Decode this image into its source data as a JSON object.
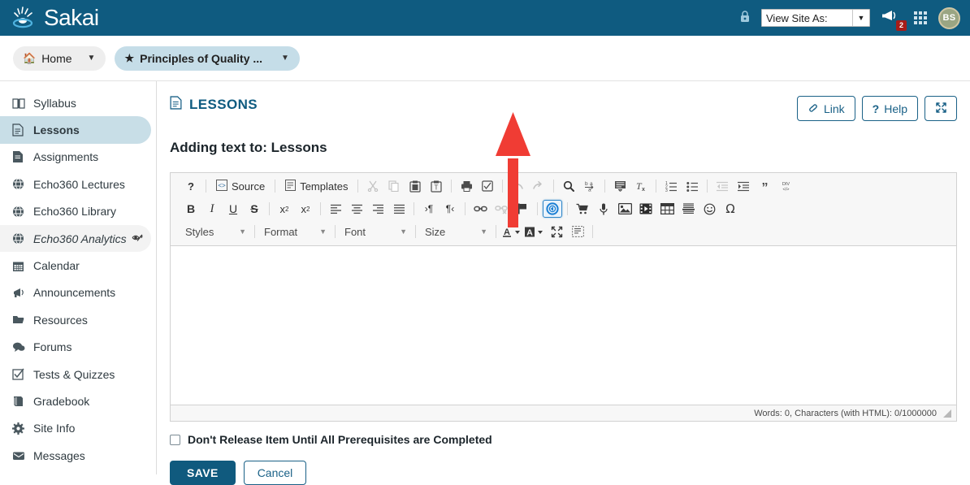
{
  "header": {
    "brand": "Sakai",
    "logo_icon": "sakai-water-drop-icon",
    "lock_icon": "lock-icon",
    "view_site_as": {
      "label": "View Site As:",
      "caret_icon": "chevron-down-icon"
    },
    "alerts": {
      "icon": "megaphone-icon",
      "badge_count": "2"
    },
    "grid_icon": "app-grid-icon",
    "avatar_initials": "BS",
    "colors": {
      "header_bg": "#0f5b80",
      "badge_red": "#a61c19"
    }
  },
  "site_nav": {
    "home": {
      "label": "Home",
      "icon": "home-icon",
      "caret_icon": "chevron-down-icon"
    },
    "site": {
      "label": "Principles of Quality ...",
      "icon": "star-icon",
      "caret_icon": "chevron-down-icon"
    }
  },
  "sidebar": {
    "items": [
      {
        "label": "Syllabus",
        "icon": "book-open-icon",
        "state": "normal"
      },
      {
        "label": "Lessons",
        "icon": "document-icon",
        "state": "active"
      },
      {
        "label": "Assignments",
        "icon": "page-edit-icon",
        "state": "normal"
      },
      {
        "label": "Echo360 Lectures",
        "icon": "globe-icon",
        "state": "normal"
      },
      {
        "label": "Echo360 Library",
        "icon": "globe-icon",
        "state": "normal"
      },
      {
        "label": "Echo360 Analytics",
        "icon": "globe-icon",
        "state": "hover",
        "suffix_icon": "eye-slash-icon"
      },
      {
        "label": "Calendar",
        "icon": "calendar-icon",
        "state": "normal"
      },
      {
        "label": "Announcements",
        "icon": "megaphone-icon",
        "state": "normal"
      },
      {
        "label": "Resources",
        "icon": "folder-open-icon",
        "state": "normal"
      },
      {
        "label": "Forums",
        "icon": "chat-bubble-icon",
        "state": "normal"
      },
      {
        "label": "Tests & Quizzes",
        "icon": "checkbox-icon",
        "state": "normal"
      },
      {
        "label": "Gradebook",
        "icon": "book-icon",
        "state": "normal"
      },
      {
        "label": "Site Info",
        "icon": "gear-icon",
        "state": "normal"
      },
      {
        "label": "Messages",
        "icon": "envelope-icon",
        "state": "normal"
      }
    ],
    "active_bg": "#c8dee7"
  },
  "main": {
    "tool_title": "LESSONS",
    "tool_title_icon": "document-icon",
    "actions": [
      {
        "label": "Link",
        "icon": "link-icon",
        "name": "link-button"
      },
      {
        "label": "Help",
        "icon": "question-icon",
        "name": "help-button"
      },
      {
        "label": "",
        "icon": "expand-arrows-icon",
        "name": "fullscreen-button"
      }
    ],
    "subtitle": "Adding text to: Lessons"
  },
  "editor": {
    "toolbar_row1": [
      {
        "name": "about-button",
        "icon": "question-mark-icon",
        "glyph": "?",
        "type": "btn",
        "state": "on"
      },
      {
        "name": "separator",
        "type": "sep"
      },
      {
        "name": "source-button",
        "icon": "source-code-icon",
        "label": "Source",
        "type": "wide",
        "state": "on"
      },
      {
        "name": "separator",
        "type": "sep"
      },
      {
        "name": "templates-button",
        "icon": "templates-icon",
        "label": "Templates",
        "type": "wide",
        "state": "on"
      },
      {
        "name": "separator",
        "type": "sep"
      },
      {
        "name": "cut-button",
        "icon": "scissors-icon",
        "glyph": "✂",
        "type": "btn",
        "state": "off"
      },
      {
        "name": "copy-button",
        "icon": "copy-icon",
        "type": "btn",
        "state": "off"
      },
      {
        "name": "paste-button",
        "icon": "paste-icon",
        "type": "btn",
        "state": "on"
      },
      {
        "name": "paste-text-button",
        "icon": "paste-text-icon",
        "type": "btn",
        "state": "on"
      },
      {
        "name": "separator",
        "type": "sep"
      },
      {
        "name": "print-button",
        "icon": "printer-icon",
        "type": "btn",
        "state": "on"
      },
      {
        "name": "spellcheck-button",
        "icon": "spellcheck-icon",
        "type": "btn",
        "state": "on"
      },
      {
        "name": "separator",
        "type": "sep"
      },
      {
        "name": "undo-button",
        "icon": "undo-arrow-icon",
        "type": "btn",
        "state": "off"
      },
      {
        "name": "redo-button",
        "icon": "redo-arrow-icon",
        "type": "btn",
        "state": "off"
      },
      {
        "name": "separator",
        "type": "sep"
      },
      {
        "name": "find-button",
        "icon": "magnifier-icon",
        "type": "btn",
        "state": "on"
      },
      {
        "name": "replace-button",
        "icon": "find-replace-icon",
        "type": "btn",
        "state": "on"
      },
      {
        "name": "separator",
        "type": "sep"
      },
      {
        "name": "select-all-button",
        "icon": "select-all-icon",
        "type": "btn",
        "state": "on"
      },
      {
        "name": "remove-format-button",
        "icon": "remove-format-icon",
        "type": "btn",
        "state": "on"
      },
      {
        "name": "separator",
        "type": "sep"
      },
      {
        "name": "numbered-list-button",
        "icon": "numbered-list-icon",
        "type": "btn",
        "state": "on"
      },
      {
        "name": "bulleted-list-button",
        "icon": "bulleted-list-icon",
        "type": "btn",
        "state": "on"
      },
      {
        "name": "separator",
        "type": "sep"
      },
      {
        "name": "outdent-button",
        "icon": "outdent-icon",
        "type": "btn",
        "state": "off"
      },
      {
        "name": "indent-button",
        "icon": "indent-icon",
        "type": "btn",
        "state": "on"
      },
      {
        "name": "blockquote-button",
        "icon": "blockquote-icon",
        "glyph": "”",
        "type": "btn",
        "state": "on"
      },
      {
        "name": "create-div-button",
        "icon": "create-div-icon",
        "type": "btn",
        "state": "on"
      }
    ],
    "toolbar_row2": [
      {
        "name": "bold-button",
        "icon": "bold-icon",
        "glyph": "B",
        "type": "txt",
        "state": "on"
      },
      {
        "name": "italic-button",
        "icon": "italic-icon",
        "glyph": "I",
        "type": "txt",
        "state": "on"
      },
      {
        "name": "underline-button",
        "icon": "underline-icon",
        "glyph": "U",
        "type": "txt",
        "state": "on"
      },
      {
        "name": "strikethrough-button",
        "icon": "strikethrough-icon",
        "glyph": "S",
        "type": "txt",
        "state": "on"
      },
      {
        "name": "separator",
        "type": "sep"
      },
      {
        "name": "subscript-button",
        "icon": "subscript-icon",
        "type": "btn",
        "state": "on"
      },
      {
        "name": "superscript-button",
        "icon": "superscript-icon",
        "type": "btn",
        "state": "on"
      },
      {
        "name": "separator",
        "type": "sep"
      },
      {
        "name": "align-left-button",
        "icon": "align-left-icon",
        "type": "btn",
        "state": "on"
      },
      {
        "name": "align-center-button",
        "icon": "align-center-icon",
        "type": "btn",
        "state": "on"
      },
      {
        "name": "align-right-button",
        "icon": "align-right-icon",
        "type": "btn",
        "state": "on"
      },
      {
        "name": "align-justify-button",
        "icon": "align-justify-icon",
        "type": "btn",
        "state": "on"
      },
      {
        "name": "separator",
        "type": "sep"
      },
      {
        "name": "ltr-button",
        "icon": "text-direction-ltr-icon",
        "type": "btn",
        "state": "on"
      },
      {
        "name": "rtl-button",
        "icon": "text-direction-rtl-icon",
        "type": "btn",
        "state": "on"
      },
      {
        "name": "separator",
        "type": "sep"
      },
      {
        "name": "link-button",
        "icon": "chain-link-icon",
        "type": "btn",
        "state": "on"
      },
      {
        "name": "unlink-button",
        "icon": "broken-link-icon",
        "type": "btn",
        "state": "off"
      },
      {
        "name": "anchor-button",
        "icon": "flag-icon",
        "type": "btn",
        "state": "on"
      },
      {
        "name": "separator",
        "type": "sep"
      },
      {
        "name": "media-button",
        "icon": "media-circle-icon",
        "type": "btn",
        "state": "highlighted"
      },
      {
        "name": "separator",
        "type": "sep"
      },
      {
        "name": "cart-button",
        "icon": "shopping-cart-icon",
        "type": "btn",
        "state": "on"
      },
      {
        "name": "audio-recorder-button",
        "icon": "microphone-icon",
        "type": "btn",
        "state": "on"
      },
      {
        "name": "image-button",
        "icon": "image-icon",
        "type": "btn",
        "state": "on"
      },
      {
        "name": "video-button",
        "icon": "film-icon",
        "type": "btn",
        "state": "on"
      },
      {
        "name": "table-button",
        "icon": "table-icon",
        "type": "btn",
        "state": "on"
      },
      {
        "name": "horizontal-rule-button",
        "icon": "horizontal-rule-icon",
        "type": "btn",
        "state": "on"
      },
      {
        "name": "smiley-button",
        "icon": "smiley-icon",
        "glyph": "☺",
        "type": "btn",
        "state": "on"
      },
      {
        "name": "special-char-button",
        "icon": "omega-icon",
        "glyph": "Ω",
        "type": "btn",
        "state": "on"
      }
    ],
    "toolbar_row3": [
      {
        "name": "styles-combo",
        "label": "Styles",
        "type": "combo",
        "cls": "cb-styles"
      },
      {
        "name": "separator",
        "type": "sep"
      },
      {
        "name": "format-combo",
        "label": "Format",
        "type": "combo",
        "cls": "cb-format"
      },
      {
        "name": "separator",
        "type": "sep"
      },
      {
        "name": "font-combo",
        "label": "Font",
        "type": "combo",
        "cls": "cb-font"
      },
      {
        "name": "separator",
        "type": "sep"
      },
      {
        "name": "size-combo",
        "label": "Size",
        "type": "combo",
        "cls": "cb-size"
      },
      {
        "name": "separator",
        "type": "sep"
      },
      {
        "name": "text-color-button",
        "icon": "text-color-icon",
        "type": "color",
        "glyph": "A",
        "state": "on"
      },
      {
        "name": "bg-color-button",
        "icon": "bg-color-icon",
        "type": "colorfill",
        "glyph": "A",
        "state": "on"
      },
      {
        "name": "maximize-button",
        "icon": "expand-arrows-icon",
        "type": "btn",
        "state": "on"
      },
      {
        "name": "show-blocks-button",
        "icon": "show-blocks-icon",
        "type": "btn",
        "state": "on"
      },
      {
        "name": "separator",
        "type": "sep"
      }
    ],
    "content": "",
    "status_text": "Words: 0, Characters (with HTML): 0/1000000",
    "resize_grip_icon": "resize-grip-icon"
  },
  "form": {
    "prerequisite_label": "Don't Release Item Until All Prerequisites are Completed",
    "prerequisite_checked": false,
    "save_label": "SAVE",
    "cancel_label": "Cancel"
  },
  "annotation": {
    "arrow_color": "#f03c34",
    "arrow_points_to": "media-circle-icon"
  }
}
